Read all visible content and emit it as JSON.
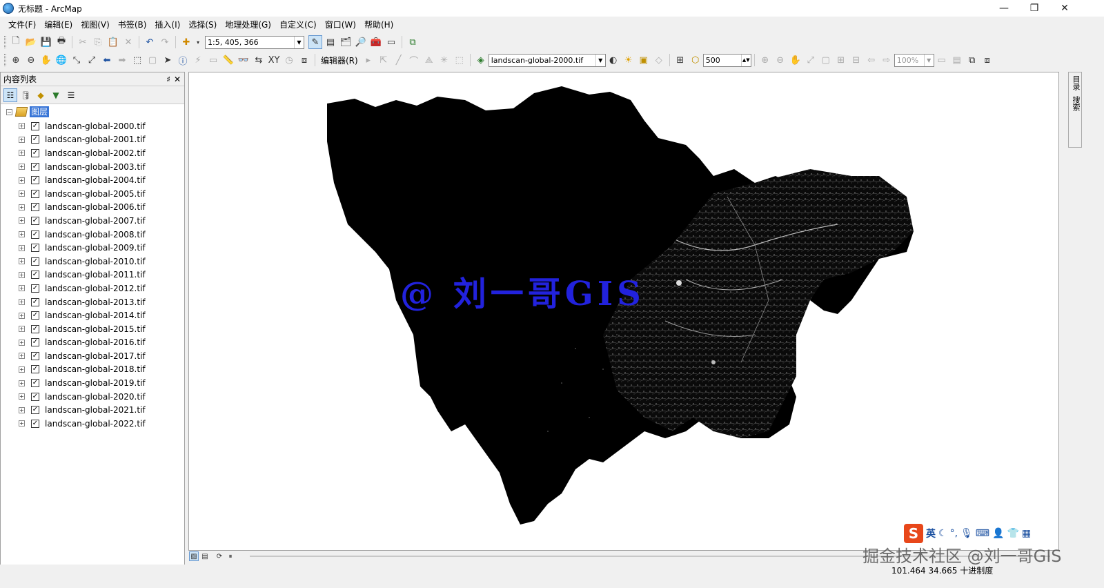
{
  "window": {
    "title": "无标题 - ArcMap",
    "minimize": "—",
    "restore": "❐",
    "close": "✕"
  },
  "menus": [
    "文件(F)",
    "编辑(E)",
    "视图(V)",
    "书签(B)",
    "插入(I)",
    "选择(S)",
    "地理处理(G)",
    "自定义(C)",
    "窗口(W)",
    "帮助(H)"
  ],
  "toolbar1": {
    "scale": "1:5, 405, 366"
  },
  "toolbar2": {
    "editor_label": "编辑器(R)",
    "active_layer": "landscan-global-2000.tif",
    "brightness_value": "500",
    "zoom_percent": "100%"
  },
  "toc": {
    "title": "内容列表",
    "pin": "♯",
    "close": "✕",
    "group_label": "图层",
    "layers": [
      "landscan-global-2000.tif",
      "landscan-global-2001.tif",
      "landscan-global-2002.tif",
      "landscan-global-2003.tif",
      "landscan-global-2004.tif",
      "landscan-global-2005.tif",
      "landscan-global-2006.tif",
      "landscan-global-2007.tif",
      "landscan-global-2008.tif",
      "landscan-global-2009.tif",
      "landscan-global-2010.tif",
      "landscan-global-2011.tif",
      "landscan-global-2012.tif",
      "landscan-global-2013.tif",
      "landscan-global-2014.tif",
      "landscan-global-2015.tif",
      "landscan-global-2016.tif",
      "landscan-global-2017.tif",
      "landscan-global-2018.tif",
      "landscan-global-2019.tif",
      "landscan-global-2020.tif",
      "landscan-global-2021.tif",
      "landscan-global-2022.tif"
    ]
  },
  "dock": {
    "catalog": "目录",
    "search": "搜索"
  },
  "map": {
    "watermark": "@ 刘一哥GIS"
  },
  "ime": {
    "lang": "英"
  },
  "overlay": {
    "juejin": "掘金技术社区 @刘一哥GIS"
  },
  "status": {
    "coords": "101.464  34.665 十进制度"
  },
  "colors": {
    "selection": "#3875d7",
    "watermark": "#2222dd"
  }
}
